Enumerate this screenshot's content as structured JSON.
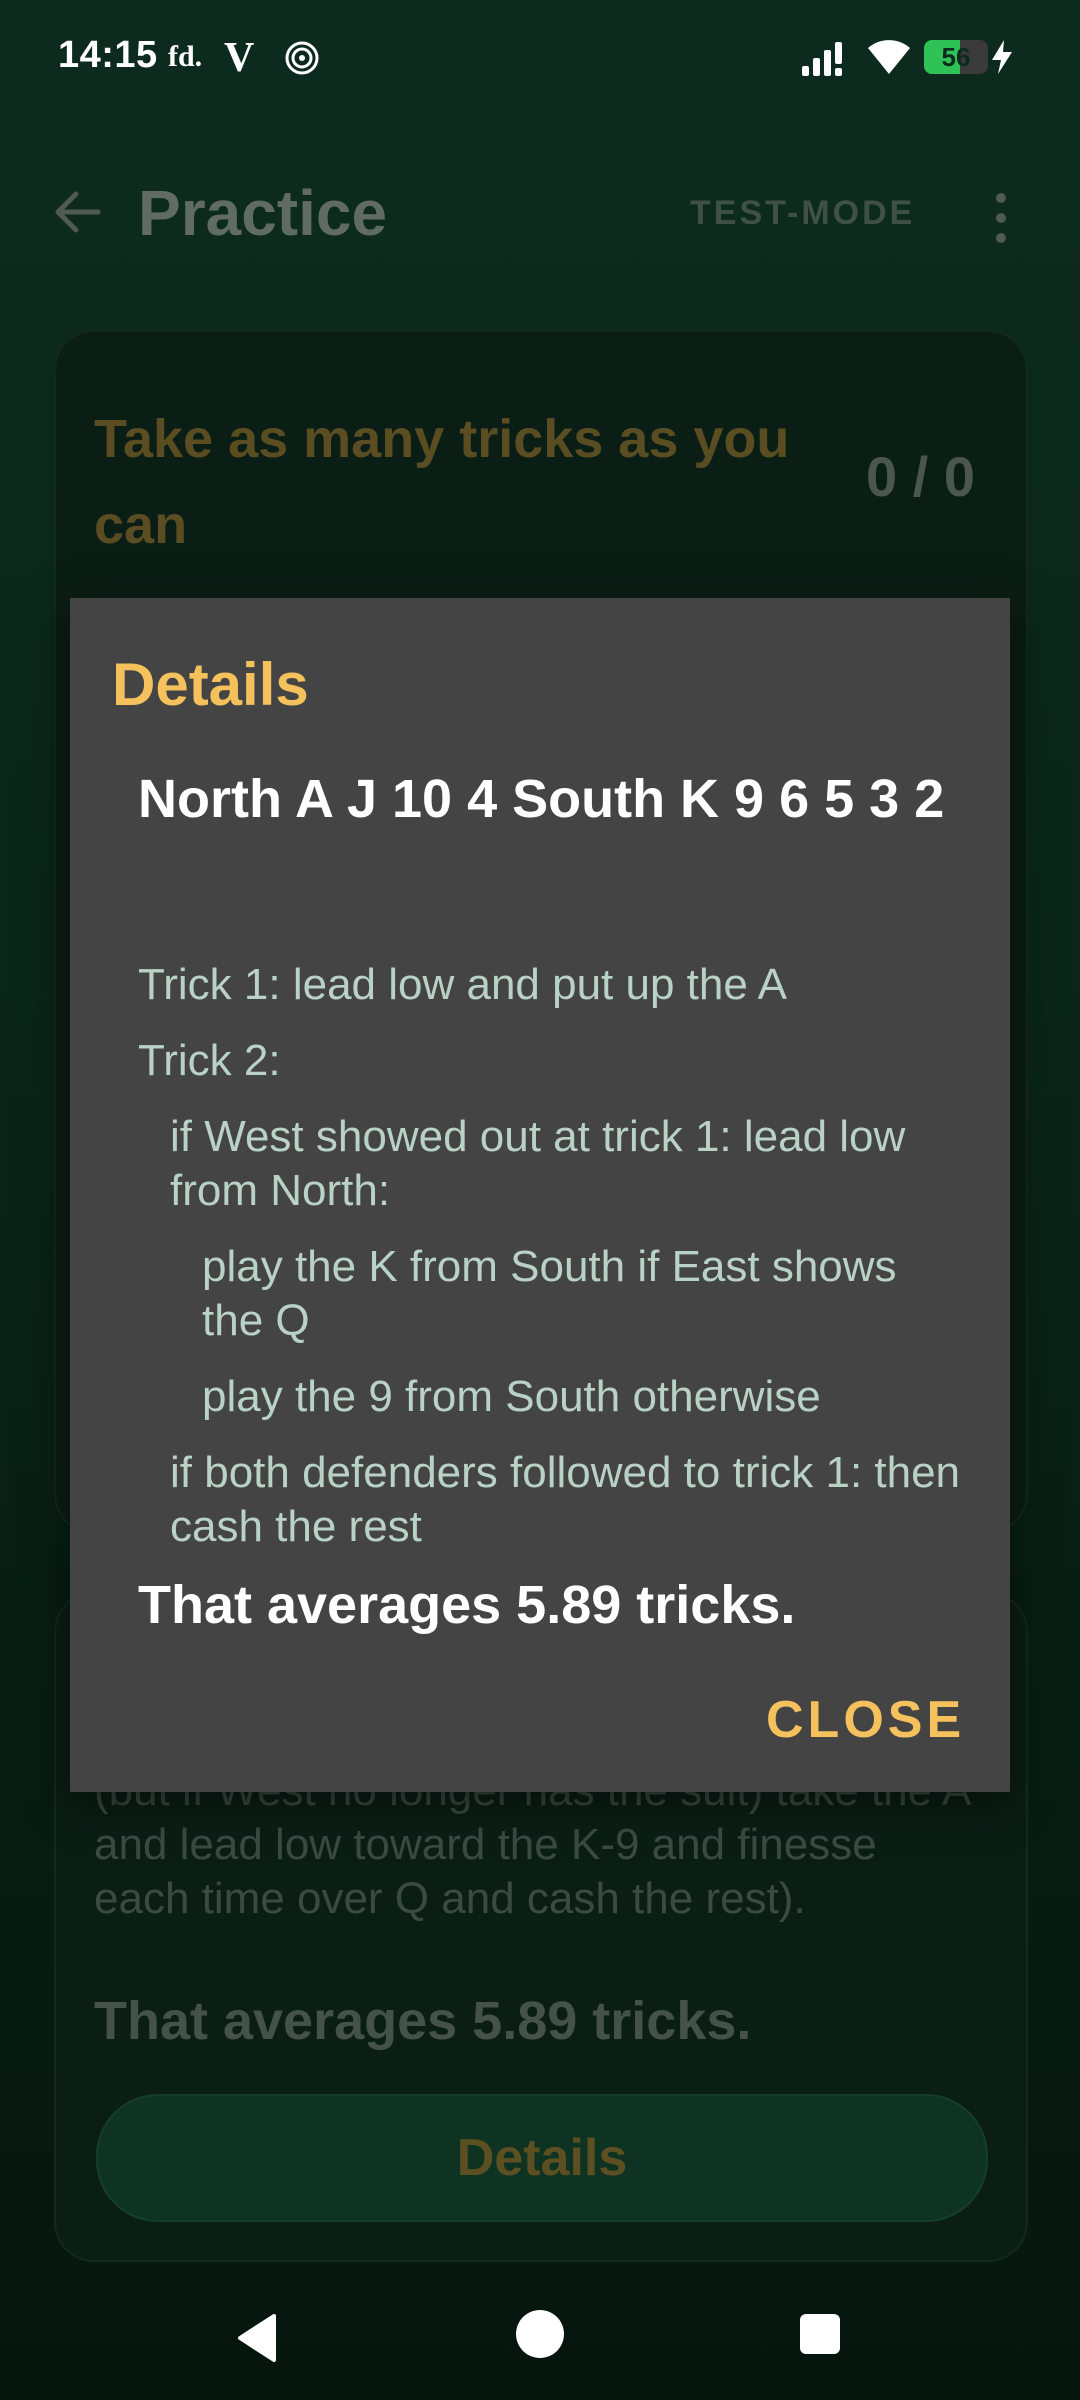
{
  "status_bar": {
    "time": "14:15",
    "icons": [
      "fd-icon",
      "v-icon",
      "spiral-icon",
      "signal-icon",
      "wifi-icon",
      "battery-icon",
      "charging-icon"
    ],
    "fd_label": "fd.",
    "v_label": "V",
    "battery_level": "56",
    "battery_fraction": 0.56
  },
  "app_bar": {
    "title": "Practice",
    "action": "TEST-MODE"
  },
  "card": {
    "title": "Take as many tricks as you can",
    "score": "0 / 0",
    "hidden_text": "(but if West no longer has the suit) take the A and lead low toward the K-9 and finesse each time over Q and cash the rest).",
    "summary": "That averages 5.89 tricks.",
    "details_button": "Details"
  },
  "dialog": {
    "title": "Details",
    "heading": "North A J 10 4 South K 9 6 5 3 2",
    "lines": [
      {
        "text": "Trick 1: lead low and put up the A",
        "indent": 0
      },
      {
        "text": "Trick 2:",
        "indent": 0
      },
      {
        "text": "if West showed out at trick 1: lead low from North:",
        "indent": 1
      },
      {
        "text": "play the K from South if East shows the Q",
        "indent": 2
      },
      {
        "text": "play the 9 from South otherwise",
        "indent": 2
      },
      {
        "text": "if both defenders followed to trick 1: then cash the rest",
        "indent": 1
      }
    ],
    "summary": "That averages 5.89 tricks.",
    "close": "CLOSE"
  },
  "colors": {
    "accent": "#f4c15c",
    "background": "#0c2b1e",
    "dialog": "#444444",
    "dialog_text": "#b9d2c5"
  }
}
